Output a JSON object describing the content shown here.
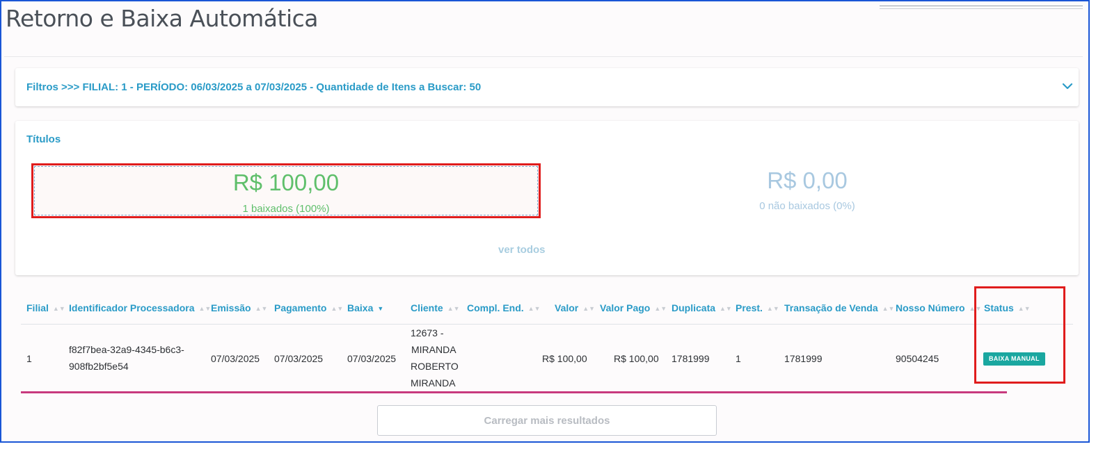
{
  "page": {
    "title": "Retorno e Baixa Automática"
  },
  "filters": {
    "summary": "Filtros >>> FILIAL: 1 - PERÍODO: 06/03/2025 a 07/03/2025 - Quantidade de Itens a Buscar: 50",
    "expand_icon": "chevron-down-icon"
  },
  "titulos": {
    "heading": "Títulos",
    "baixados": {
      "amount": "R$ 100,00",
      "label": "1 baixados (100%)"
    },
    "nao_baixados": {
      "amount": "R$ 0,00",
      "label": "0 não baixados (0%)"
    },
    "ver_todos": "ver todos"
  },
  "table": {
    "columns": [
      "Filial",
      "Identificador Processadora",
      "Emissão",
      "Pagamento",
      "Baixa",
      "Cliente",
      "Compl. End.",
      "Valor",
      "Valor Pago",
      "Duplicata",
      "Prest.",
      "Transação de Venda",
      "Nosso Número",
      "Status"
    ],
    "sorted_column": "Baixa",
    "rows": [
      {
        "filial": "1",
        "identificador_l1": "f82f7bea-32a9-4345-b6c3-",
        "identificador_l2": "908fb2bf5e54",
        "emissao": "07/03/2025",
        "pagamento": "07/03/2025",
        "baixa": "07/03/2025",
        "cliente_l1": "12673 -",
        "cliente_l2": "MIRANDA",
        "cliente_l3": "ROBERTO",
        "cliente_l4": "MIRANDA",
        "compl_end": "",
        "valor": "R$ 100,00",
        "valor_pago": "R$ 100,00",
        "duplicata": "1781999",
        "prest": "1",
        "transacao_venda": "1781999",
        "nosso_numero": "90504245",
        "status": "BAIXA MANUAL"
      }
    ]
  },
  "load_more_label": "Carregar mais resultados",
  "colors": {
    "accent": "#2a9bc7",
    "success": "#5fbf6b",
    "muted_blue": "#a8c8e0",
    "status_badge": "#1aa7a0",
    "highlight_red": "#e01c1c",
    "frame_blue": "#1a56d6"
  }
}
